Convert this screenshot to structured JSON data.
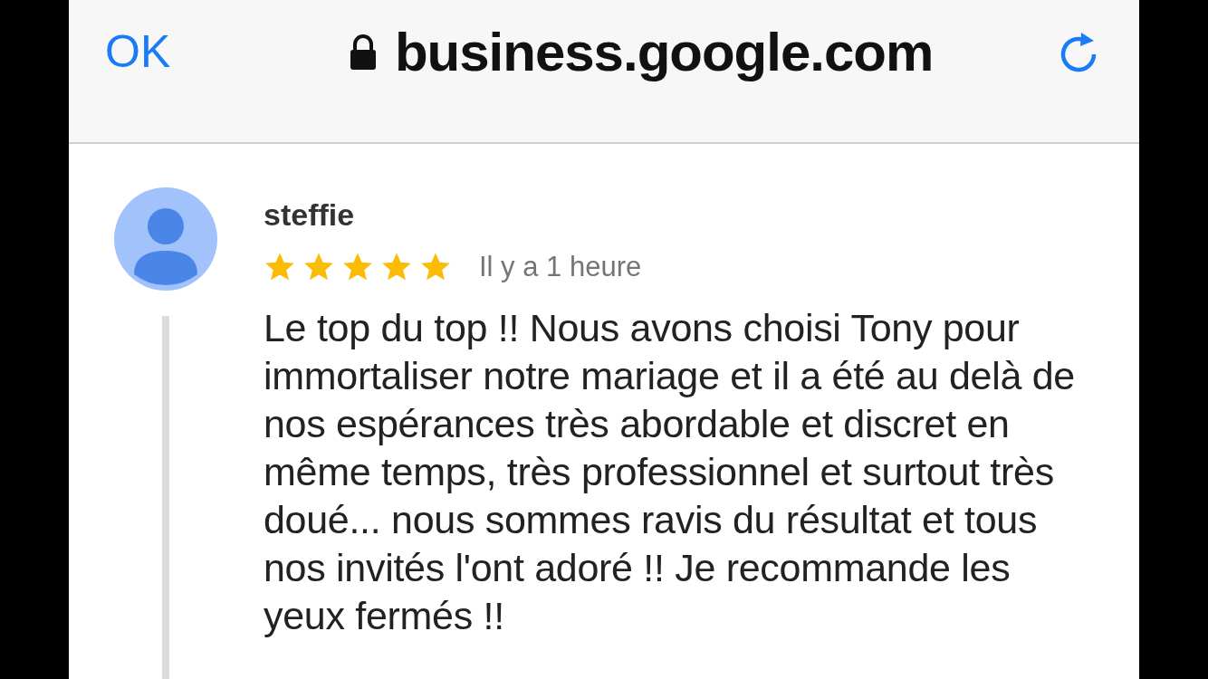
{
  "browser_bar": {
    "done_button": "OK",
    "address": "business.google.com"
  },
  "review": {
    "author": "steffie",
    "stars": 5,
    "time": "Il y a 1 heure",
    "text": "Le top du top !! Nous avons choisi Tony pour immortaliser notre mariage et il a été au delà de nos espérances très abordable et discret en même temps, très professionnel et surtout très doué... nous sommes ravis du résultat et tous nos invités l'ont adoré !! Je recommande les yeux fermés !!"
  }
}
